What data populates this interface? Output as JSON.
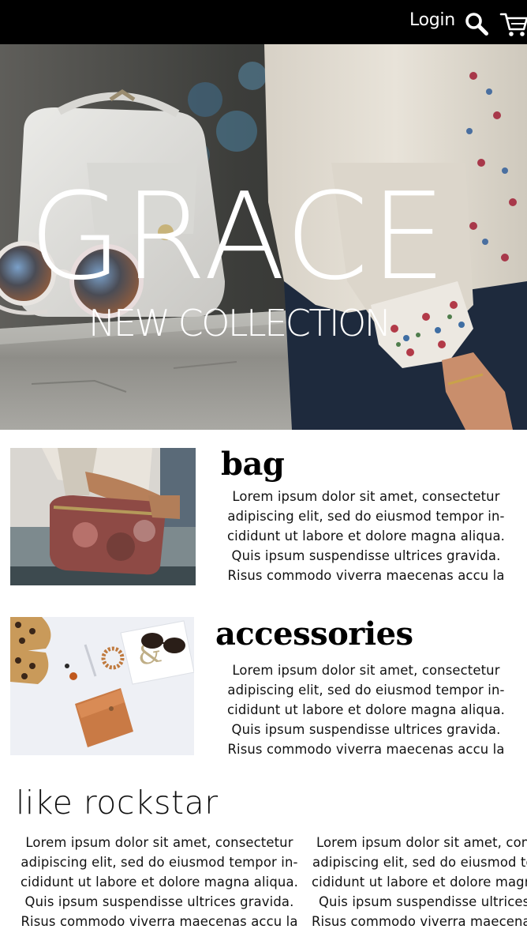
{
  "header": {
    "login_label": "Login",
    "search_icon": "search-icon",
    "cart_icon": "cart-icon"
  },
  "hero": {
    "title": "GRACE",
    "subtitle": "NEW COLLECTION"
  },
  "categories": [
    {
      "title": "bag",
      "lines": [
        "Lorem ipsum dolor sit amet, consectetur",
        "adipiscing elit, sed do eiusmod tempor in-",
        "cididunt ut labore et dolore magna aliqua.",
        "Quis ipsum suspendisse ultrices gravida.",
        "Risus commodo viverra maecenas accu la"
      ]
    },
    {
      "title": "accessories",
      "lines": [
        "Lorem ipsum dolor sit amet, consectetur",
        "adipiscing elit, sed do eiusmod tempor in-",
        "cididunt ut labore et dolore magna aliqua.",
        "Quis ipsum suspendisse ultrices gravida.",
        "Risus commodo viverra maecenas accu la"
      ]
    }
  ],
  "rockstar": {
    "heading": "like rockstar",
    "columns": [
      {
        "lines": [
          "Lorem ipsum dolor sit amet, consectetur",
          "adipiscing elit, sed do eiusmod tempor in-",
          "cididunt ut labore et dolore magna aliqua.",
          "Quis ipsum suspendisse ultrices gravida.",
          "Risus commodo viverra maecenas accu la"
        ]
      },
      {
        "lines": [
          "Lorem ipsum dolor sit amet, consectetur",
          "adipiscing elit, sed do eiusmod tempor in-",
          "cididunt ut labore et dolore magna aliqua.",
          "Quis ipsum suspendisse ultrices gravida.",
          "Risus commodo viverra maecenas accu la"
        ]
      }
    ]
  },
  "colors": {
    "topbar": "#000000",
    "background": "#ffffff",
    "text": "#111111"
  }
}
